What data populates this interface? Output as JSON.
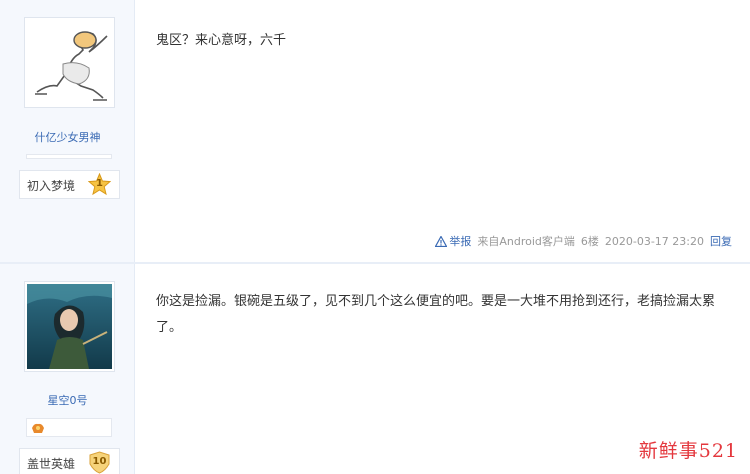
{
  "posts": [
    {
      "username": "什亿少女男神",
      "level_name": "初入梦境",
      "level_num": "1",
      "content": "鬼区？来心意呀，六千",
      "report_label": "举报",
      "source": "来自Android客户端",
      "floor": "6楼",
      "timestamp": "2020-03-17 23:20",
      "reply_label": "回复"
    },
    {
      "username": "星空0号",
      "level_name": "盖世英雄",
      "level_num": "10",
      "content": "你这是捡漏。银碗是五级了，见不到几个这么便宜的吧。要是一大堆不用抢到还行，老搞捡漏太累了。"
    }
  ],
  "watermark": "新鲜事521",
  "colors": {
    "link": "#3a6ab4",
    "sidebar_bg": "#f5f8fd",
    "watermark": "#e4383e",
    "level_star": "#f6c343"
  }
}
